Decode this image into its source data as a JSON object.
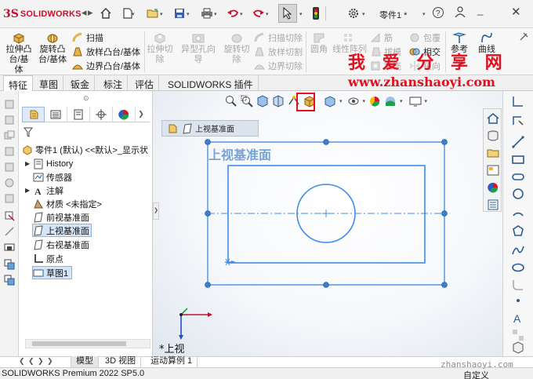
{
  "app": {
    "logo_ds": "3S",
    "logo_text": "SOLIDWORKS",
    "document_title": "零件1 *"
  },
  "commands": {
    "extrude_boss": "拉伸凸\n台/基体",
    "revolve_boss": "旋转凸\n台/基体",
    "sweep": "扫描",
    "loft": "放样凸台/基体",
    "boundary": "边界凸台/基体",
    "extrude_cut": "拉伸切\n除",
    "hole_wizard": "异型孔向导",
    "revolve_cut": "旋转切\n除",
    "swept_cut": "扫描切除",
    "lofted_cut": "放样切割",
    "boundary_cut": "边界切除",
    "fillet": "圆角",
    "linear_pattern": "线性阵列",
    "rib": "筋",
    "draft": "拔模",
    "shell": "抽壳",
    "wrap": "包覆",
    "intersect": "相交",
    "mirror": "镜向",
    "reference": "参考\n...",
    "curves": "曲线"
  },
  "tabs": [
    "特征",
    "草图",
    "钣金",
    "标注",
    "评估",
    "SOLIDWORKS 插件"
  ],
  "tabs_active": "特征",
  "watermark": {
    "title": "我 爱 分 享 网",
    "url": "www.zhanshaoyi.com",
    "bottom": "zhanshaoyi.com"
  },
  "feature_tree": {
    "root": "零件1 (默认) <<默认>_显示状",
    "items": [
      {
        "label": "History",
        "expandable": true
      },
      {
        "label": "传感器",
        "expandable": false
      },
      {
        "label": "注解",
        "expandable": true
      },
      {
        "label": "材质 <未指定>",
        "expandable": false
      },
      {
        "label": "前视基准面",
        "expandable": false
      },
      {
        "label": "上视基准面",
        "expandable": false
      },
      {
        "label": "右视基准面",
        "expandable": false
      },
      {
        "label": "原点",
        "expandable": false
      },
      {
        "label": "草图1",
        "expandable": false
      }
    ]
  },
  "graphics": {
    "breadcrumb": "上视基准面",
    "plane_label": "上视基准面",
    "view_label": "*上视"
  },
  "bottom_tabs": [
    "模型",
    "3D 视图",
    "运动算例 1"
  ],
  "bottom_tabs_active": "模型",
  "status": {
    "left": "SOLIDWORKS Premium 2022 SP5.0",
    "right": "自定义"
  },
  "icons": {
    "nav": [
      "chevron-left-icon",
      "chevron-right-icon"
    ],
    "quick_access": [
      "home-icon",
      "new-document-icon",
      "open-folder-icon",
      "save-icon",
      "print-icon",
      "undo-icon",
      "redo-icon",
      "select-arrow-icon",
      "traffic-light-icon",
      "options-gear-icon"
    ],
    "window": [
      "help-question-icon",
      "user-icon",
      "minimize-icon",
      "close-icon"
    ]
  },
  "colors": {
    "brand_red": "#c8102e",
    "sketch_blue": "#3d8ee6",
    "watermark_red": "#e0101e",
    "highlight_red": "#e0101e"
  }
}
